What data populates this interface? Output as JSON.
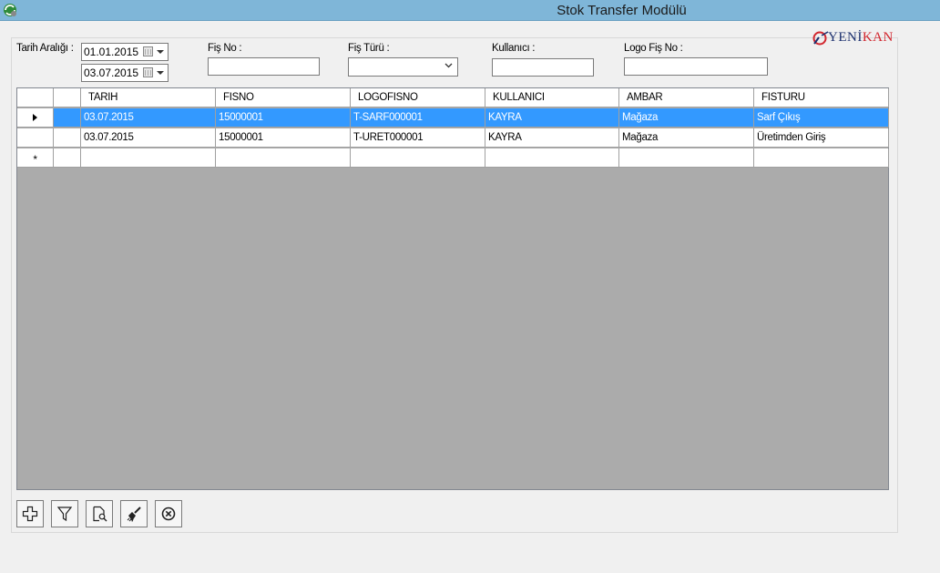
{
  "window": {
    "title": "Stok Transfer Modülü"
  },
  "logo": {
    "prefix": "YENİ",
    "suffix": "KAN"
  },
  "filters": {
    "date_range_label": "Tarih Aralığı :",
    "date_from": "01.01.2015",
    "date_to": "03.07.2015",
    "fis_no_label": "Fiş No :",
    "fis_no_value": "",
    "fis_turu_label": "Fiş Türü :",
    "fis_turu_value": "",
    "kullanici_label": "Kullanıcı :",
    "kullanici_value": "",
    "logo_fis_no_label": "Logo Fiş No :",
    "logo_fis_no_value": ""
  },
  "grid": {
    "columns": [
      "TARIH",
      "FISNO",
      "LOGOFISNO",
      "KULLANICI",
      "AMBAR",
      "FISTURU"
    ],
    "rows": [
      [
        "03.07.2015",
        "15000001",
        "T-SARF000001",
        "KAYRA",
        "Mağaza",
        "Sarf Çıkış"
      ],
      [
        "03.07.2015",
        "15000001",
        "T-URET000001",
        "KAYRA",
        "Mağaza",
        "Üretimden Giriş"
      ]
    ],
    "selected_row": 0,
    "new_row_marker": "*"
  },
  "toolbar": {
    "buttons": [
      "add-icon",
      "filter-icon",
      "preview-icon",
      "clear-icon",
      "close-icon"
    ]
  },
  "colors": {
    "titlebar": "#7fb6d8",
    "selection": "#3399ff"
  }
}
